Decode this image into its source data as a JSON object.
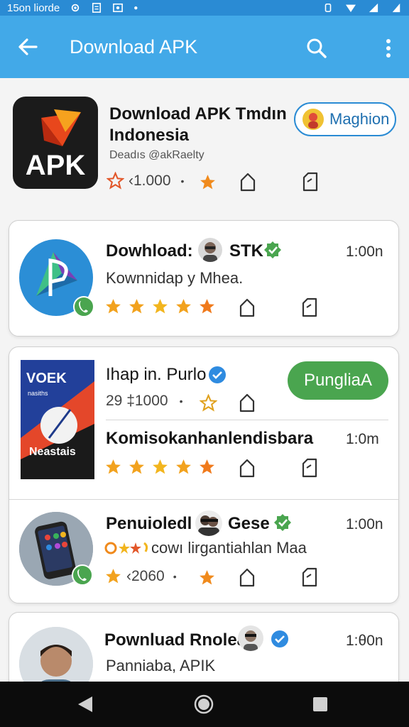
{
  "status": {
    "time": "15on liorde"
  },
  "appbar": {
    "title": "Download APK"
  },
  "featured": {
    "title_line1": "Download APK Tmdın",
    "title_line2": "Indonesia",
    "developer": "Deadıs @akRaelty",
    "count": "‹1.000",
    "icon_text": "APK",
    "button_label": "Maghion"
  },
  "items": [
    {
      "title": "Dowhload:",
      "tag": "STK",
      "time": "1:00n",
      "subtitle": "Kownnidap  y Mhea."
    },
    {
      "title": "Ihap in. Purlo",
      "count": "29 ‡1000",
      "button_label": "PungliaA",
      "icon_text_top": "VOEK",
      "icon_text_small": "nasiths",
      "icon_text_bottom": "Neastais"
    },
    {
      "title": "Komisokanhanlendisbara",
      "time": "1:0m"
    },
    {
      "title": "Penuioledl",
      "tag": "Gese",
      "time": "1:00n",
      "subtitle": "cowı lirgantiahlan Maa",
      "count": "‹2060"
    },
    {
      "title": "Pownluad Rnolea",
      "time": "1:θ0n",
      "subtitle": "Panniaba, APIK"
    }
  ],
  "colors": {
    "appbar": "#42a9e8",
    "status": "#2a8bd4",
    "star": "#f08a1c",
    "green": "#4aa54f"
  }
}
